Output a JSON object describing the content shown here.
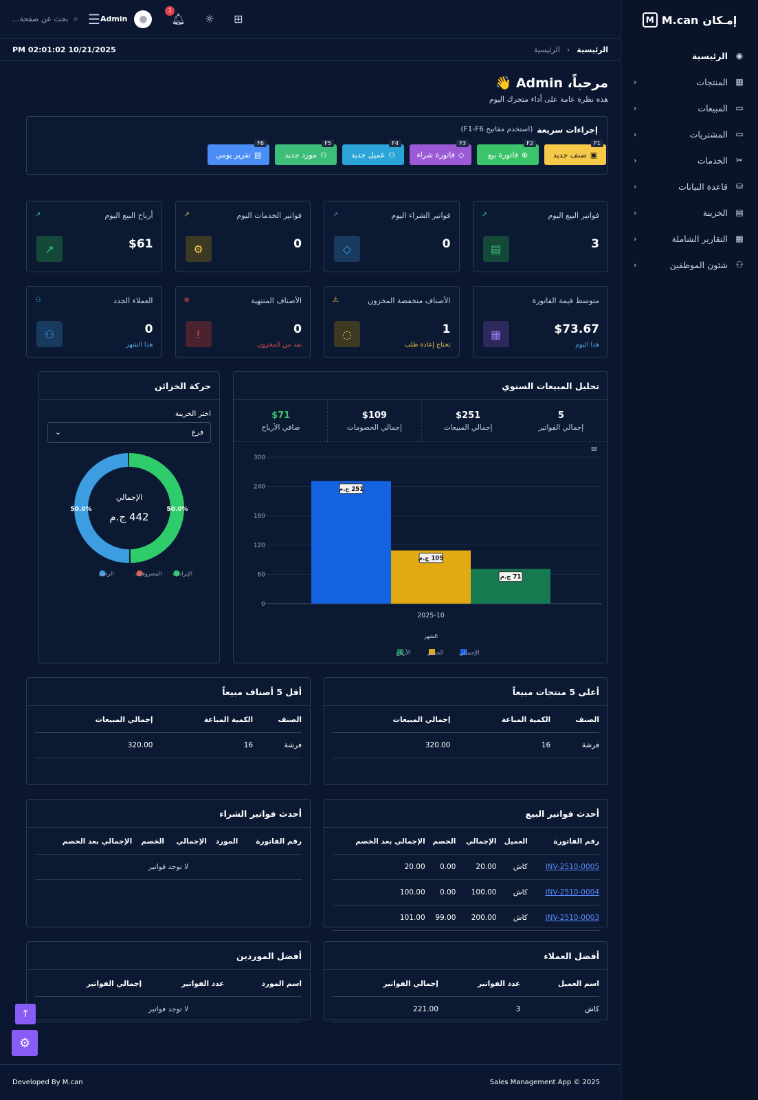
{
  "sidebar": {
    "brand_prefix": "إمـكان",
    "brand_name": "M.can",
    "items": [
      {
        "label": "الرئيسية",
        "icon": "dashboard-icon"
      },
      {
        "label": "المنتجات",
        "icon": "products-icon"
      },
      {
        "label": "المبيعات",
        "icon": "sales-icon"
      },
      {
        "label": "المشتريات",
        "icon": "purchases-icon"
      },
      {
        "label": "الخدمات",
        "icon": "services-icon"
      },
      {
        "label": "قاعدة البيانات",
        "icon": "database-icon"
      },
      {
        "label": "الخزينة",
        "icon": "treasury-icon"
      },
      {
        "label": "التقارير الشاملة",
        "icon": "reports-icon"
      },
      {
        "label": "شئون الموظفين",
        "icon": "employees-icon"
      }
    ]
  },
  "topbar": {
    "search_placeholder": "بحث عن صفحة...",
    "user": "Admin",
    "notifications": "1"
  },
  "breadcrumb": {
    "current": "الرئيسية",
    "home": "الرئيسية"
  },
  "clock": "PM 02:01:02 10/21/2025",
  "welcome": {
    "title": "مرحباً، Admin 👋",
    "subtitle": "هذه نظرة عامة على أداء متجرك اليوم"
  },
  "quick_actions": {
    "title": "إجراءات سريعة",
    "hint": "(استخدم مفاتيح F1-F6)",
    "buttons": [
      {
        "label": "صنف جديد",
        "key": "F1",
        "color": "#f7c948",
        "text": "#1a1a1a",
        "icon": "box-icon"
      },
      {
        "label": "فاتورة بيع",
        "key": "F2",
        "color": "#3cc46b",
        "text": "#fff",
        "icon": "plus-circle-icon"
      },
      {
        "label": "فاتورة شراء",
        "key": "F3",
        "color": "#9b59d6",
        "text": "#fff",
        "icon": "tag-icon"
      },
      {
        "label": "عميل جديد",
        "key": "F4",
        "color": "#2ba4d8",
        "text": "#fff",
        "icon": "user-plus-icon"
      },
      {
        "label": "مورد جديد",
        "key": "F5",
        "color": "#3cbe7a",
        "text": "#fff",
        "icon": "supplier-icon"
      },
      {
        "label": "تقرير يومي",
        "key": "F6",
        "color": "#4a8ef5",
        "text": "#fff",
        "icon": "report-icon"
      }
    ]
  },
  "stats": [
    {
      "title": "فواتير البيع اليوم",
      "value": "3",
      "note": "",
      "icon": "receipt-icon",
      "bg": "#14493a",
      "fg": "#3cc46b"
    },
    {
      "title": "فواتير الشراء اليوم",
      "value": "0",
      "note": "",
      "icon": "tag-icon",
      "bg": "#173a5e",
      "fg": "#3b9be8"
    },
    {
      "title": "فواتير الخدمات اليوم",
      "value": "0",
      "note": "",
      "icon": "gear-icon",
      "bg": "#3d3a24",
      "fg": "#f2c84b"
    },
    {
      "title": "أرباح البيع اليوم",
      "value": "$61",
      "note": "",
      "icon": "trend-up-icon",
      "bg": "#14493a",
      "fg": "#3cc46b"
    },
    {
      "title": "متوسط قيمة الفاتورة",
      "value": "$73.67",
      "note": "هذا اليوم",
      "note_color": "#5aa8e8",
      "icon": "calculator-icon",
      "bg": "#2c2a5c",
      "fg": "#9b79f0"
    },
    {
      "title": "الأصناف منخفضة المخزون",
      "value": "1",
      "note": "تحتاج إعادة طلب",
      "note_color": "#f2c84b",
      "icon": "eye-off-icon",
      "bg": "#3d3a24",
      "fg": "#f2c84b"
    },
    {
      "title": "الأصناف المنتهية",
      "value": "0",
      "note": "نفذ من المخزون",
      "note_color": "#e0504a",
      "icon": "alert-icon",
      "bg": "#4a2330",
      "fg": "#e0504a"
    },
    {
      "title": "العملاء الجدد",
      "value": "0",
      "note": "هذا الشهر",
      "note_color": "#5aa8e8",
      "icon": "user-plus-icon",
      "bg": "#173a5e",
      "fg": "#3b9be8"
    }
  ],
  "sales_analysis": {
    "title": "تحليل المبيعات السنوي",
    "summary": [
      {
        "value": "5",
        "label": "إجمالي الفواتير",
        "color": "#ffffff"
      },
      {
        "value": "$251",
        "label": "إجمالي المبيعات",
        "color": "#ffffff"
      },
      {
        "value": "$109",
        "label": "إجمالي الخصومات",
        "color": "#ffffff"
      },
      {
        "value": "$71",
        "label": "صافي الأرباح",
        "color": "#3cc46b"
      }
    ]
  },
  "chart_data": [
    {
      "type": "bar",
      "categories": [
        "2025-10"
      ],
      "series": [
        {
          "name": "الإجمالي",
          "values": [
            251
          ],
          "color": "#1463e0",
          "label": "251 ج.م"
        },
        {
          "name": "الخصم",
          "values": [
            109
          ],
          "color": "#e2aa12",
          "label": "109 ج.م"
        },
        {
          "name": "الأرباح",
          "values": [
            71
          ],
          "color": "#167a50",
          "label": "71 ج.م"
        }
      ],
      "yticks": [
        "300",
        "240",
        "180",
        "120",
        "60",
        "0"
      ],
      "ylim": [
        0,
        300
      ],
      "xlabel": "الشهر",
      "legend": "bottom"
    },
    {
      "type": "pie",
      "title": "حركة الخزائن",
      "center_label": "الإجمالي",
      "center_value": "442 ج.م",
      "slices": [
        {
          "name": "الإيرادات",
          "value": 50.0,
          "label": "50.0%",
          "color": "#2ecc6b"
        },
        {
          "name": "المصروفات",
          "value": 0,
          "label": "",
          "color": "#e05a4a"
        },
        {
          "name": "الرصيد",
          "value": 50.0,
          "label": "50.0%",
          "color": "#3c9ee0"
        }
      ],
      "legend": "bottom"
    }
  ],
  "treasury": {
    "title": "حركة الخزائن",
    "select_label": "اختر الخزينة",
    "select_value": "فرع"
  },
  "top_products": {
    "title": "أعلى 5 منتجات مبيعاً",
    "columns": [
      "الصنف",
      "الكمية المباعة",
      "إجمالي المبيعات"
    ],
    "rows": [
      [
        "فرشة",
        "16",
        "320.00"
      ]
    ]
  },
  "low_products": {
    "title": "أقل 5 أصناف مبيعاً",
    "columns": [
      "الصنف",
      "الكمية المباعة",
      "إجمالي المبيعات"
    ],
    "rows": [
      [
        "فرشة",
        "16",
        "320.00"
      ]
    ]
  },
  "sales_invoices": {
    "title": "أحدث فواتير البيع",
    "columns": [
      "رقم الفاتورة",
      "العميل",
      "الإجمالي",
      "الخصم",
      "الإجمالي بعد الخصم"
    ],
    "rows": [
      [
        "INV-2510-0005",
        "كاش",
        "20.00",
        "0.00",
        "20.00"
      ],
      [
        "INV-2510-0004",
        "كاش",
        "100.00",
        "0.00",
        "100.00"
      ],
      [
        "INV-2510-0003",
        "كاش",
        "200.00",
        "99.00",
        "101.00"
      ]
    ]
  },
  "purchase_invoices": {
    "title": "أحدث فواتير الشراء",
    "columns": [
      "رقم الفاتورة",
      "المورد",
      "الإجمالي",
      "الخصم",
      "الإجمالي بعد الخصم"
    ],
    "empty": "لا توجد فواتير"
  },
  "top_customers": {
    "title": "أفضل العملاء",
    "columns": [
      "اسم العميل",
      "عدد الفواتير",
      "إجمالي الفواتير"
    ],
    "rows": [
      [
        "كاش",
        "3",
        "221.00"
      ]
    ]
  },
  "top_suppliers": {
    "title": "أفضل الموردين",
    "columns": [
      "اسم المورد",
      "عدد الفواتير",
      "إجمالي الفواتير"
    ],
    "empty": "لا توجد فواتير"
  },
  "footer": {
    "copyright": "Sales Management App © 2025",
    "developer": "Developed By M.can"
  }
}
